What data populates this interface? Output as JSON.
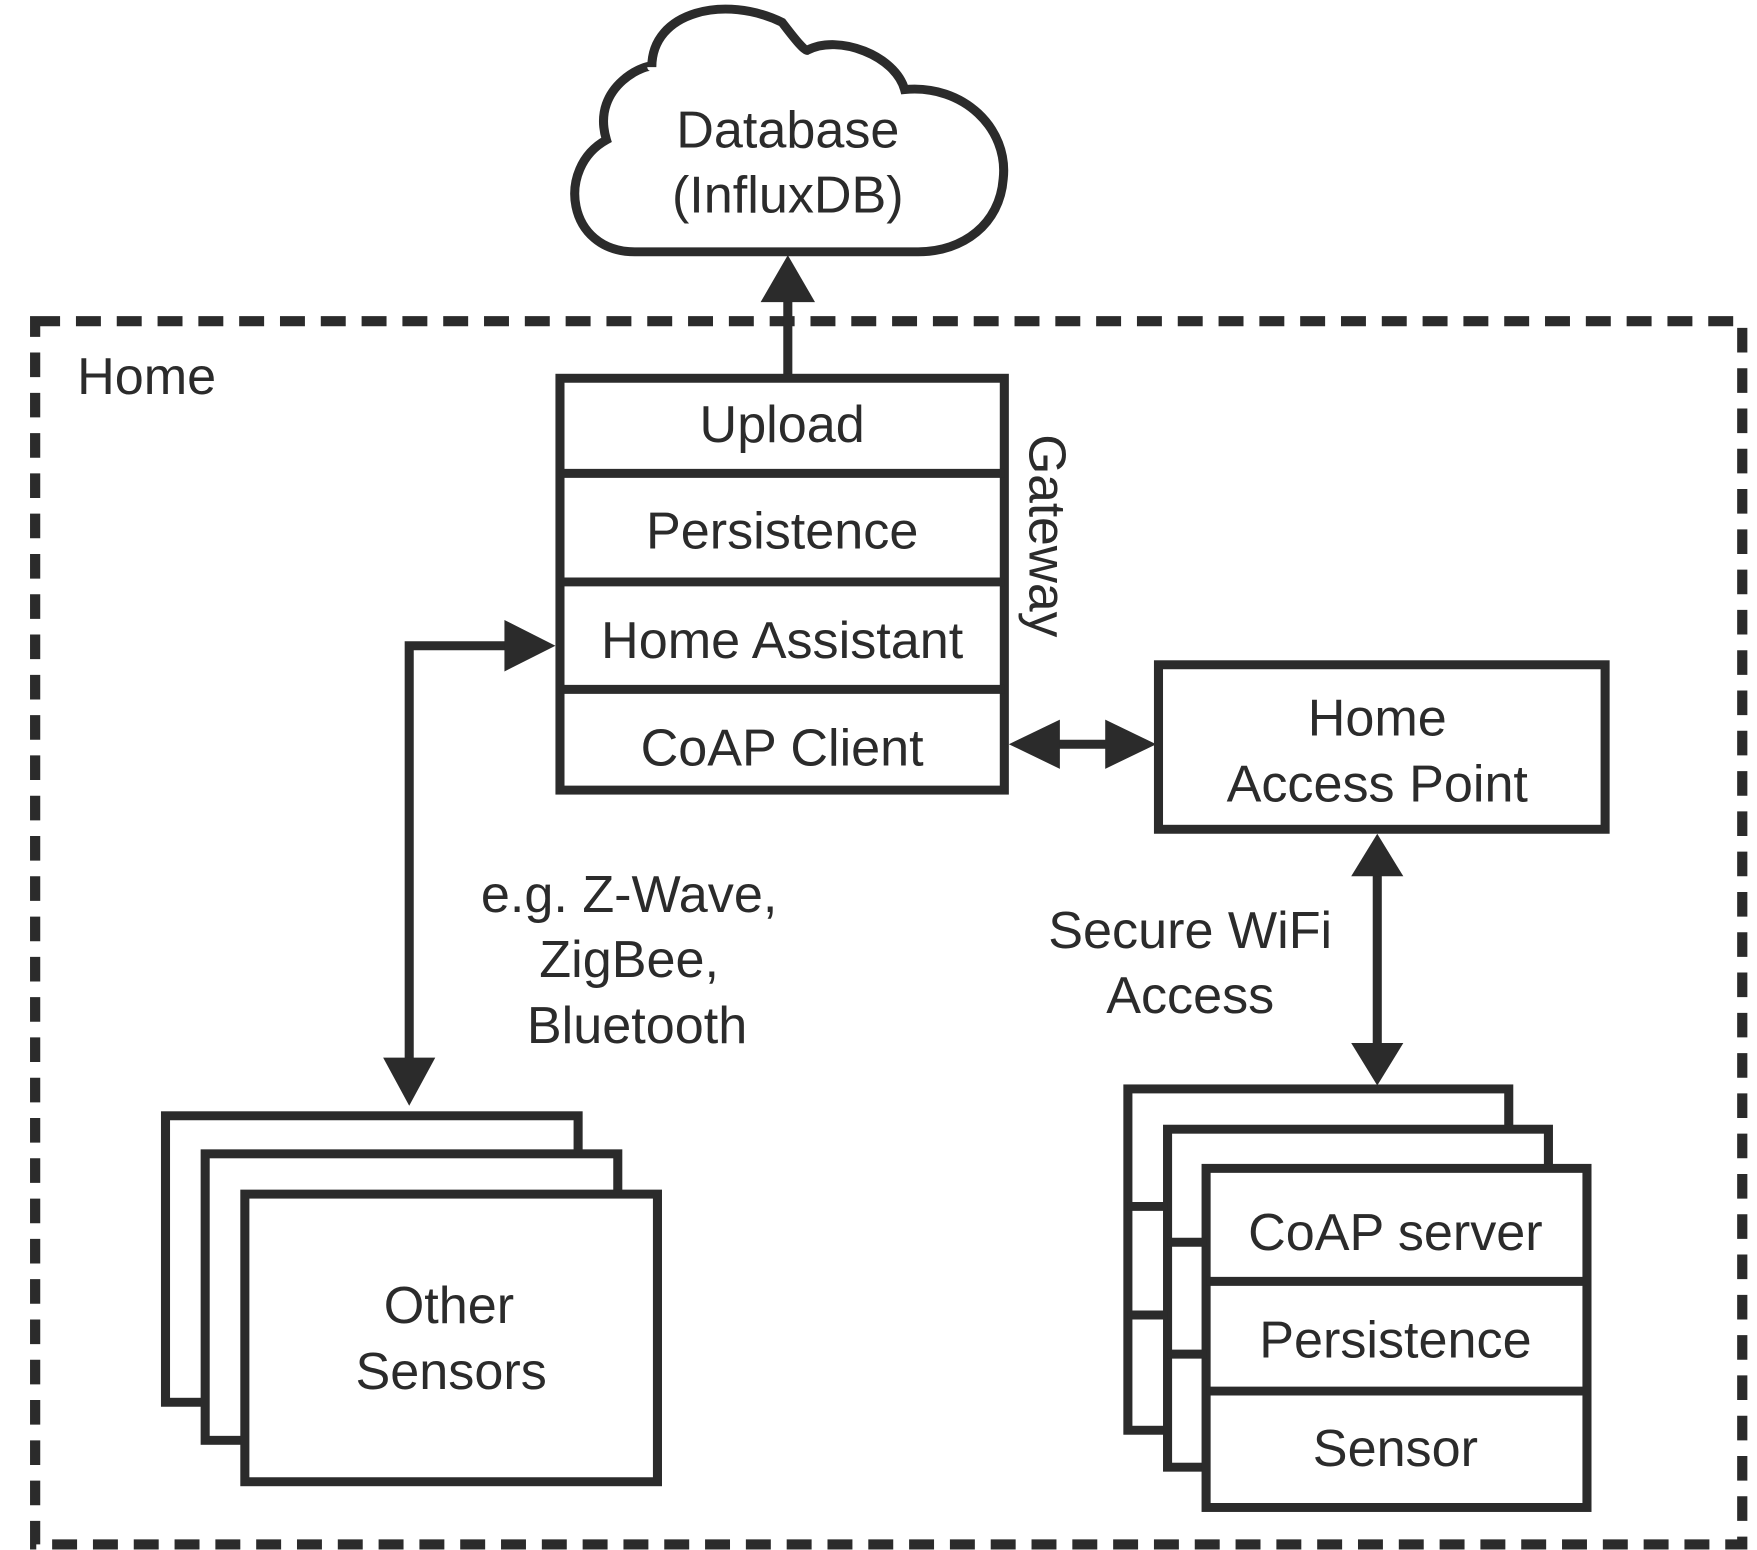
{
  "cloud": {
    "line1": "Database",
    "line2": "(InfluxDB)"
  },
  "home": {
    "label": "Home"
  },
  "gateway": {
    "label": "Gateway",
    "layers": [
      "Upload",
      "Persistence",
      "Home Assistant",
      "CoAP Client"
    ]
  },
  "access_point": {
    "line1": "Home",
    "line2": "Access Point"
  },
  "other_protocols": {
    "line1": "e.g. Z-Wave,",
    "line2": "ZigBee,",
    "line3": "Bluetooth"
  },
  "wifi": {
    "line1": "Secure WiFi",
    "line2": "Access"
  },
  "other_sensors": {
    "line1": "Other",
    "line2": "Sensors"
  },
  "sensor_node": {
    "layers": [
      "CoAP server",
      "Persistence",
      "Sensor"
    ]
  },
  "colors": {
    "stroke": "#2b2b2b",
    "background": "#ffffff"
  }
}
